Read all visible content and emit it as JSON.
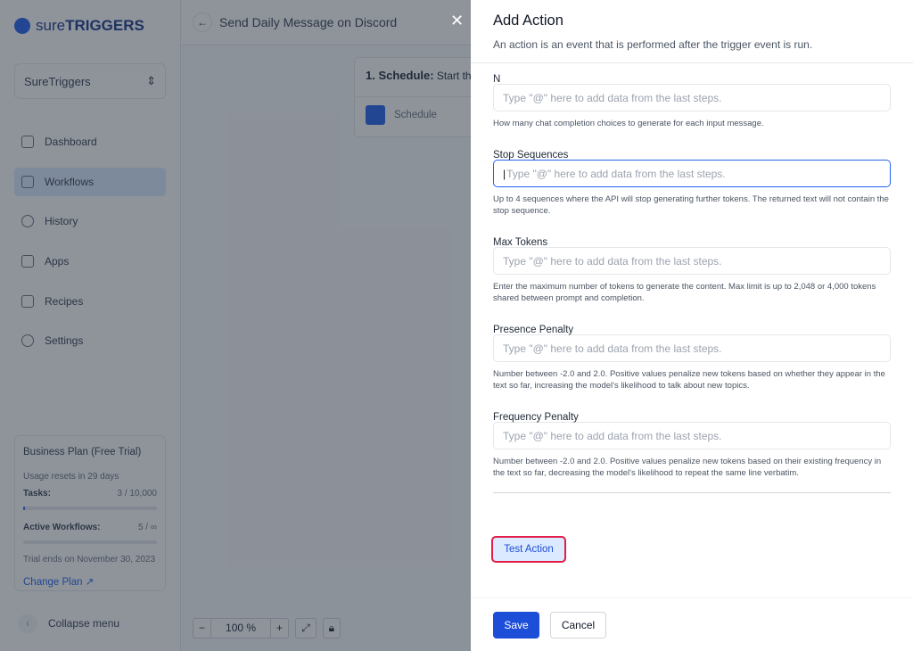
{
  "brand": {
    "logo_text_light": "sure",
    "logo_text_bold": "TRIGGERS"
  },
  "workspace": {
    "selected": "SureTriggers"
  },
  "sidebar": {
    "items": [
      {
        "label": "Dashboard",
        "icon": "grid-icon"
      },
      {
        "label": "Workflows",
        "icon": "workflow-icon",
        "active": true
      },
      {
        "label": "History",
        "icon": "history-icon"
      },
      {
        "label": "Apps",
        "icon": "apps-icon"
      },
      {
        "label": "Recipes",
        "icon": "recipes-icon"
      },
      {
        "label": "Settings",
        "icon": "gear-icon"
      }
    ],
    "collapse_label": "Collapse menu"
  },
  "plan": {
    "title": "Business Plan (Free Trial)",
    "reset": "Usage resets in 29 days",
    "tasks_label": "Tasks:",
    "tasks_value": "3 / 10,000",
    "tasks_progress": 0.0003,
    "workflows_label": "Active Workflows:",
    "workflows_value": "5 / ∞",
    "trial_end": "Trial ends on November 30, 2023",
    "change_plan": "Change Plan"
  },
  "workflow": {
    "title": "Send Daily Message on Discord",
    "step_title": "1. Schedule:",
    "step_desc": "Start the",
    "step_app": "Schedule",
    "zoom": "100 %"
  },
  "panel": {
    "title": "Add Action",
    "subtitle": "An action is an event that is performed after the trigger event is run.",
    "fields": [
      {
        "label": "N",
        "placeholder": "Type \"@\" here to add data from the last steps.",
        "help": "How many chat completion choices to generate for each input message."
      },
      {
        "label": "Stop Sequences",
        "placeholder": "Type \"@\" here to add data from the last steps.",
        "help": "Up to 4 sequences where the API will stop generating further tokens. The returned text will not contain the stop sequence.",
        "focused": true
      },
      {
        "label": "Max Tokens",
        "placeholder": "Type \"@\" here to add data from the last steps.",
        "help": "Enter the maximum number of tokens to generate the content. Max limit is up to 2,048 or 4,000 tokens shared between prompt and completion."
      },
      {
        "label": "Presence Penalty",
        "placeholder": "Type \"@\" here to add data from the last steps.",
        "help": "Number between -2.0 and 2.0. Positive values penalize new tokens based on whether they appear in the text so far, increasing the model's likelihood to talk about new topics."
      },
      {
        "label": "Frequency Penalty",
        "placeholder": "Type \"@\" here to add data from the last steps.",
        "help": "Number between -2.0 and 2.0. Positive values penalize new tokens based on their existing frequency in the text so far, decreasing the model's likelihood to repeat the same line verbatim."
      }
    ],
    "test_label": "Test Action",
    "save_label": "Save",
    "cancel_label": "Cancel"
  },
  "colors": {
    "accent": "#1d4ed8",
    "highlight": "#e11d48"
  }
}
